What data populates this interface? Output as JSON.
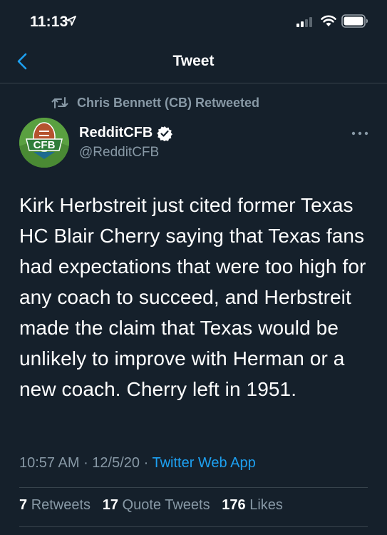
{
  "status_bar": {
    "time": "11:13"
  },
  "nav": {
    "title": "Tweet"
  },
  "retweet": {
    "label": "Chris Bennett (CB) Retweeted"
  },
  "author": {
    "name": "RedditCFB",
    "handle": "@RedditCFB",
    "avatar_text": "CFB",
    "verified": true
  },
  "tweet": {
    "text": "Kirk Herbstreit just cited former Texas HC Blair Cherry saying that Texas fans had expectations that were too high for any coach to succeed, and Herbstreit made the claim that Texas would be unlikely to improve with Herman or a new coach. Cherry left in 1951.",
    "time": "10:57 AM",
    "date": "12/5/20",
    "source": "Twitter Web App"
  },
  "stats": {
    "retweets_count": "7",
    "retweets_label": "Retweets",
    "quotes_count": "17",
    "quotes_label": "Quote Tweets",
    "likes_count": "176",
    "likes_label": "Likes"
  },
  "colors": {
    "background": "#15202b",
    "accent": "#1da1f2",
    "secondary_text": "#8899a6",
    "divider": "#38444d"
  },
  "icons": {
    "back": "chevron-left-icon",
    "retweet": "retweet-icon",
    "verified": "verified-badge-icon",
    "more": "more-horizontal-icon",
    "location": "location-arrow-icon",
    "signal": "cellular-signal-icon",
    "wifi": "wifi-icon",
    "battery": "battery-icon"
  }
}
